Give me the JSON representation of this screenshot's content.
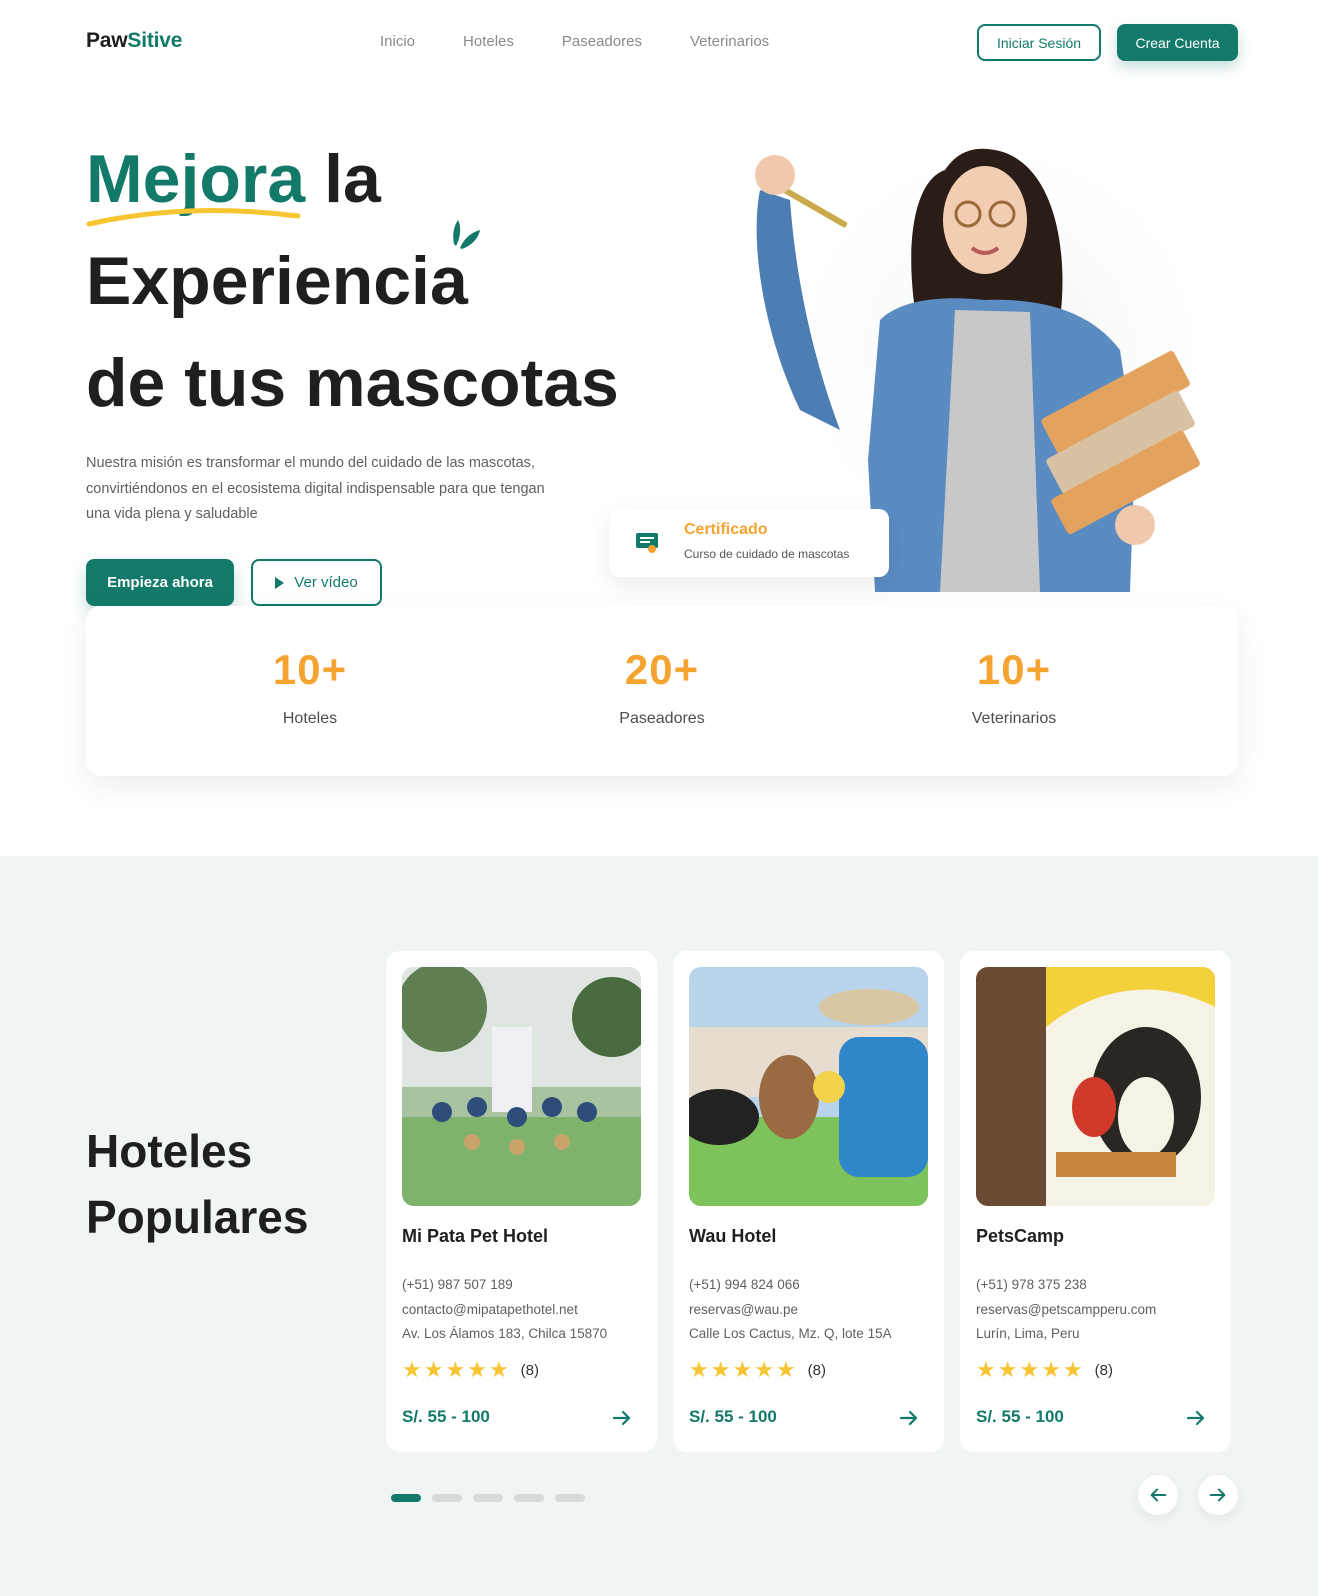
{
  "brand": {
    "logo_part1": "Paw",
    "logo_part2": "Sitive",
    "accent": "#137a6a",
    "highlight": "#f5a431",
    "star": "#f7c531"
  },
  "nav": {
    "links": [
      "Inicio",
      "Hoteles",
      "Paseadores",
      "Veterinarios"
    ],
    "login_label": "Iniciar Sesión",
    "signup_label": "Crear Cuenta"
  },
  "hero": {
    "title_highlight": "Mejora",
    "title_rest_1": " la",
    "title_line2": "Experiencia",
    "title_line3": "de tus mascotas",
    "description": "Nuestra misión es transformar el mundo del cuidado de las mascotas, convirtiéndonos en el ecosistema digital indispensable para que tengan una vida plena y saludable",
    "start_label": "Empieza ahora",
    "video_label": "Ver vídeo",
    "certificate_title": "Certificado",
    "certificate_subtitle": "Curso de cuidado de mascotas"
  },
  "stats": [
    {
      "value": "10+",
      "label": "Hoteles"
    },
    {
      "value": "20+",
      "label": "Paseadores"
    },
    {
      "value": "10+",
      "label": "Veterinarios"
    }
  ],
  "popular": {
    "title_line1": "Hoteles",
    "title_line2": "Populares",
    "hotels": [
      {
        "name": "Mi Pata Pet Hotel",
        "phone": "(+51) 987 507 189",
        "email": "contacto@mipatapethotel.net",
        "address": "Av. Los Álamos 183, Chilca 15870",
        "reviews": "(8)",
        "rating": 5,
        "price": "S/. 55 - 100"
      },
      {
        "name": "Wau Hotel",
        "phone": "(+51) 994 824 066",
        "email": "reservas@wau.pe",
        "address": "Calle Los Cactus, Mz. Q, lote 15A",
        "reviews": "(8)",
        "rating": 5,
        "price": "S/. 55 - 100"
      },
      {
        "name": "PetsCamp",
        "phone": "(+51) 978 375 238",
        "email": "reservas@petscampperu.com",
        "address": "Lurín, Lima, Peru",
        "reviews": "(8)",
        "rating": 5,
        "price": "S/. 55 - 100"
      }
    ],
    "carousel_pages": 5,
    "carousel_active": 1
  }
}
